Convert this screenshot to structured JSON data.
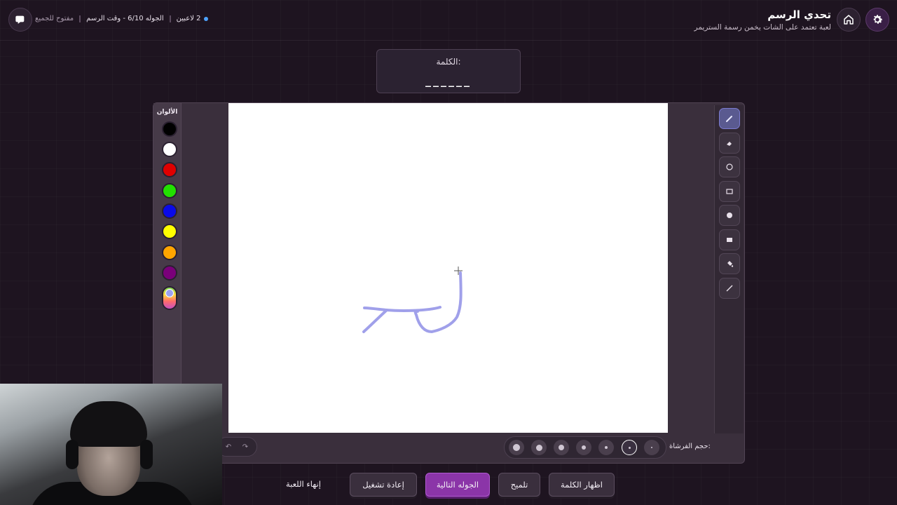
{
  "header": {
    "title": "تحدي الرسم",
    "subtitle": "لعبة تعتمد على الشات يخمن رسمة الستريمر",
    "status": {
      "players": "2 لاعبين",
      "round_time": "الجوله 6/10 - وقت الرسم",
      "access": "مفتوح للجميع"
    },
    "icons": [
      "gear-icon",
      "home-icon",
      "logo-icon"
    ]
  },
  "word": {
    "label": "الكلمة:",
    "blanks": "______"
  },
  "colors": {
    "title": "الألوان",
    "swatches": [
      "#000000",
      "#ffffff",
      "#e00000",
      "#22e000",
      "#0a0ae8",
      "#ffff00",
      "#ffa500",
      "#7a007a"
    ],
    "custom_color": "#9ba2f0"
  },
  "tools": [
    "brush-icon",
    "eraser-icon",
    "circle-outline-icon",
    "rectangle-outline-icon",
    "circle-filled-icon",
    "rectangle-filled-icon",
    "fill-bucket-icon",
    "line-icon"
  ],
  "brush": {
    "label": "حجم الفرشاة:",
    "stroke_color": "#a0a0ea"
  },
  "actions": {
    "show_word": "اظهار الكلمة",
    "hint": "تلميح",
    "next_round": "الجوله التالية",
    "restart": "إعادة تشغيل",
    "end_game": "إنهاء اللعبة"
  }
}
